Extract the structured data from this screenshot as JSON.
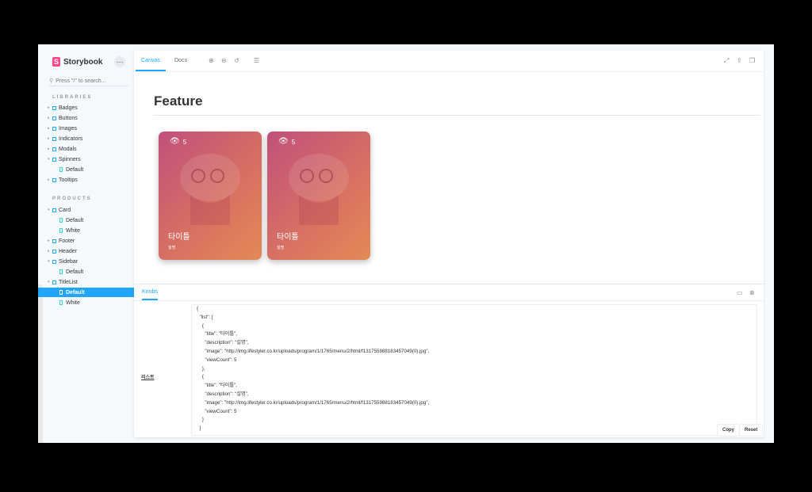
{
  "sidebar": {
    "logo_text": "Storybook",
    "logo_mark": "S",
    "menu_icon": "ellipsis-icon",
    "search_placeholder": "Press \"/\" to search...",
    "sections": [
      {
        "label": "LIBRARIES"
      },
      {
        "label": "PRODUCTS"
      }
    ],
    "items": [
      {
        "label": "Badges"
      },
      {
        "label": "Buttons"
      },
      {
        "label": "Images"
      },
      {
        "label": "Indicators"
      },
      {
        "label": "Modals"
      },
      {
        "label": "Spinners"
      },
      {
        "label": "Default"
      },
      {
        "label": "Tooltips"
      },
      {
        "label": "Card"
      },
      {
        "label": "Default"
      },
      {
        "label": "White"
      },
      {
        "label": "Footer"
      },
      {
        "label": "Header"
      },
      {
        "label": "Sidebar"
      },
      {
        "label": "Default"
      },
      {
        "label": "TitleList"
      },
      {
        "label": "Default"
      },
      {
        "label": "White"
      }
    ]
  },
  "toolbar": {
    "tabs": [
      {
        "label": "Canvas"
      },
      {
        "label": "Docs"
      }
    ],
    "icons": [
      "zoom-in-icon",
      "zoom-out-icon",
      "zoom-reset-icon",
      "grid-icon",
      "fullscreen-icon",
      "share-icon",
      "copy-icon"
    ]
  },
  "canvas": {
    "title": "Feature",
    "cards": [
      {
        "title": "타이틀",
        "description": "설명",
        "view_count": "5"
      },
      {
        "title": "타이틀",
        "description": "설명",
        "view_count": "5"
      }
    ]
  },
  "addons": {
    "tab_label": "Knobs",
    "knob_label": "리스트",
    "knob_value": "{\n  \"list\": [\n    {\n      \"title\": \"타이틀\",\n      \"description\": \"설명\",\n      \"image\": \"http://img.lifestyler.co.kr/uploads/program/1/1765/menu/2/html/f131755988183457049(0).jpg\",\n      \"viewCount\": 5\n    },\n    {\n      \"title\": \"타이틀\",\n      \"description\": \"설명\",\n      \"image\": \"http://img.lifestyler.co.kr/uploads/program/1/1765/menu/2/html/f131755988183457049(0).jpg\",\n      \"viewCount\": 5\n    }\n  ]",
    "copy_label": "Copy",
    "reset_label": "Reset"
  },
  "colors": {
    "accent": "#1ea7fd",
    "brand": "#ff4785",
    "card_gradient_start": "#c0507c",
    "card_gradient_end": "#e38a56"
  }
}
